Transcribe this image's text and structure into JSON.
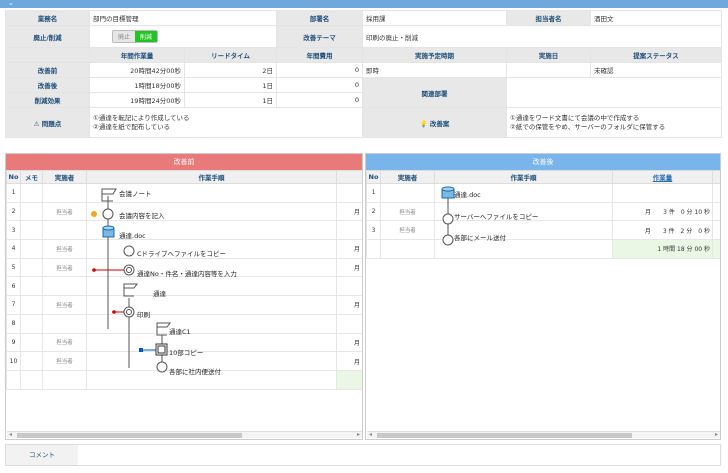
{
  "header": {
    "labels": {
      "business": "業務名",
      "department": "部署名",
      "owner": "担当者名",
      "abolish": "廃止/削減",
      "theme": "改善テーマ"
    },
    "business_name": "部門の目標管理",
    "department_name": "採用課",
    "owner_name": "酒田文",
    "toggle": {
      "off": "廃止",
      "on": "削減"
    },
    "theme_value": "印刷の廃止・削減"
  },
  "metrics": {
    "columns": [
      "年間作業量",
      "リードタイム",
      "年間費用",
      "実施予定時期",
      "実施日",
      "提案ステータス"
    ],
    "rows": [
      {
        "label": "改善前",
        "work": "20時間42分00秒",
        "lead": "2日",
        "cost": "0",
        "planned": "即時",
        "date": "",
        "status": "未確認"
      },
      {
        "label": "改善後",
        "work": "1時間18分00秒",
        "lead": "1日",
        "cost": "0"
      },
      {
        "label": "削減効果",
        "work": "19時間24分00秒",
        "lead": "1日",
        "cost": "0"
      }
    ],
    "related_label": "関連部署"
  },
  "issues": {
    "problem_label": "問題点",
    "problem_lines": [
      "①通達を転記により作成している",
      "②通達を紙で配布している"
    ],
    "improvement_label": "改善案",
    "improvement_lines": [
      "①通達をワード文書にて会議の中で作成する",
      "②紙での保管をやめ、サーバーのフォルダに保管する"
    ]
  },
  "before": {
    "title": "改善前",
    "columns": [
      "No",
      "メモ",
      "実施者",
      "作業手順"
    ],
    "rows": [
      {
        "no": "1",
        "actor": ""
      },
      {
        "no": "2",
        "actor": "担当者"
      },
      {
        "no": "3",
        "actor": ""
      },
      {
        "no": "4",
        "actor": "担当者"
      },
      {
        "no": "5",
        "actor": "担当者"
      },
      {
        "no": "6",
        "actor": ""
      },
      {
        "no": "7",
        "actor": "担当者"
      },
      {
        "no": "8",
        "actor": ""
      },
      {
        "no": "9",
        "actor": "担当者"
      },
      {
        "no": "10",
        "actor": "担当者"
      }
    ],
    "steps": [
      "会議ノート",
      "会議内容を記入",
      "通達.doc",
      "Cドライブへファイルをコピー",
      "通達No・件名・通達内容等を入力",
      "通達",
      "印刷",
      "通達C1",
      "10部コピー",
      "各部に社内便送付"
    ],
    "side_marks": [
      "月",
      "月",
      "月",
      "月",
      "月",
      "月"
    ]
  },
  "after": {
    "title": "改善後",
    "columns": [
      "No",
      "実施者",
      "作業手順",
      "作業量"
    ],
    "rows": [
      {
        "no": "1",
        "actor": "",
        "volume": ""
      },
      {
        "no": "2",
        "actor": "担当者",
        "volume": "月　　3 件　0 分 10 秒"
      },
      {
        "no": "3",
        "actor": "担当者",
        "volume": "月　　3 件　2 分　0 秒"
      }
    ],
    "total": "1 時間 18 分 00 秒",
    "steps": [
      "通達.doc",
      "サーバーへファイルをコピー",
      "各部にメール送付"
    ]
  },
  "comment": {
    "label": "コメント"
  },
  "colors": {
    "before_header": "#e87a7a",
    "after_header": "#79b4ea",
    "topbar": "#6fa8dc"
  }
}
